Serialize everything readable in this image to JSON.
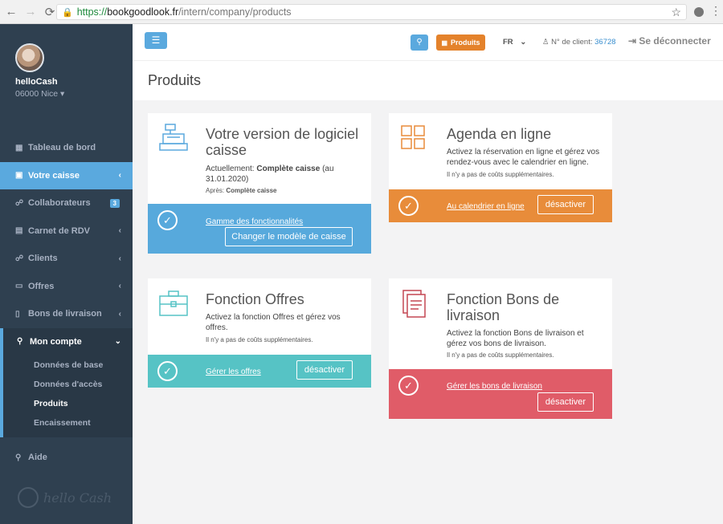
{
  "browser": {
    "nav_back": "←",
    "nav_forward": "→",
    "nav_reload": "⟳",
    "url_scheme": "https://",
    "url_host": "bookgoodlook.fr",
    "url_path": "/intern/company/products"
  },
  "sidebar": {
    "profile_name": "helloCash",
    "profile_city": "06000 Nice ▾",
    "items": [
      {
        "label": "Tableau de bord",
        "icon": "dashboard-icon"
      },
      {
        "label": "Votre caisse",
        "icon": "cash-register-icon"
      },
      {
        "label": "Collaborateurs",
        "icon": "team-icon",
        "badge": "3"
      },
      {
        "label": "Carnet de RDV",
        "icon": "calendar-icon"
      },
      {
        "label": "Clients",
        "icon": "clients-icon"
      },
      {
        "label": "Offres",
        "icon": "briefcase-icon"
      },
      {
        "label": "Bons de livraison",
        "icon": "delivery-icon"
      }
    ],
    "account": {
      "label": "Mon compte",
      "subitems": [
        "Données de base",
        "Données d'accès",
        "Produits",
        "Encaissement"
      ]
    },
    "help": "Aide",
    "brand": "hello Cash"
  },
  "topbar": {
    "products_label": "Produits",
    "lang": "FR",
    "client_label": "N° de client:",
    "client_number": "36728",
    "logout": "Se déconnecter"
  },
  "page": {
    "title": "Produits"
  },
  "cards": {
    "caisse": {
      "title": "Votre version de logiciel caisse",
      "current_prefix": "Actuellement:",
      "current_value": "Complète caisse",
      "current_date": "(au 31.01.2020)",
      "after_prefix": "Après:",
      "after_value": "Complète caisse",
      "link": "Gamme des fonctionnalités",
      "button": "Changer le modèle de caisse",
      "color": "#57a9dc"
    },
    "agenda": {
      "title": "Agenda en ligne",
      "text": "Activez la réservation en ligne et gérez vos rendez-vous avec le calendrier en ligne.",
      "note": "Il n'y a pas de coûts supplémentaires.",
      "link": "Au calendrier en ligne",
      "button": "désactiver",
      "color": "#e88c3a"
    },
    "offres": {
      "title": "Fonction Offres",
      "text": "Activez la fonction Offres et gérez vos offres.",
      "note": "Il n'y a pas de coûts supplémentaires.",
      "link": "Gérer les offres",
      "button": "désactiver",
      "color": "#56c3c5"
    },
    "bons": {
      "title": "Fonction Bons de livraison",
      "text": "Activez la fonction Bons de livraison et gérez vos bons de livraison.",
      "note": "Il n'y a pas de coûts supplémentaires.",
      "link": "Gérer les bons de livraison",
      "button": "désactiver",
      "color": "#e05c68"
    }
  }
}
